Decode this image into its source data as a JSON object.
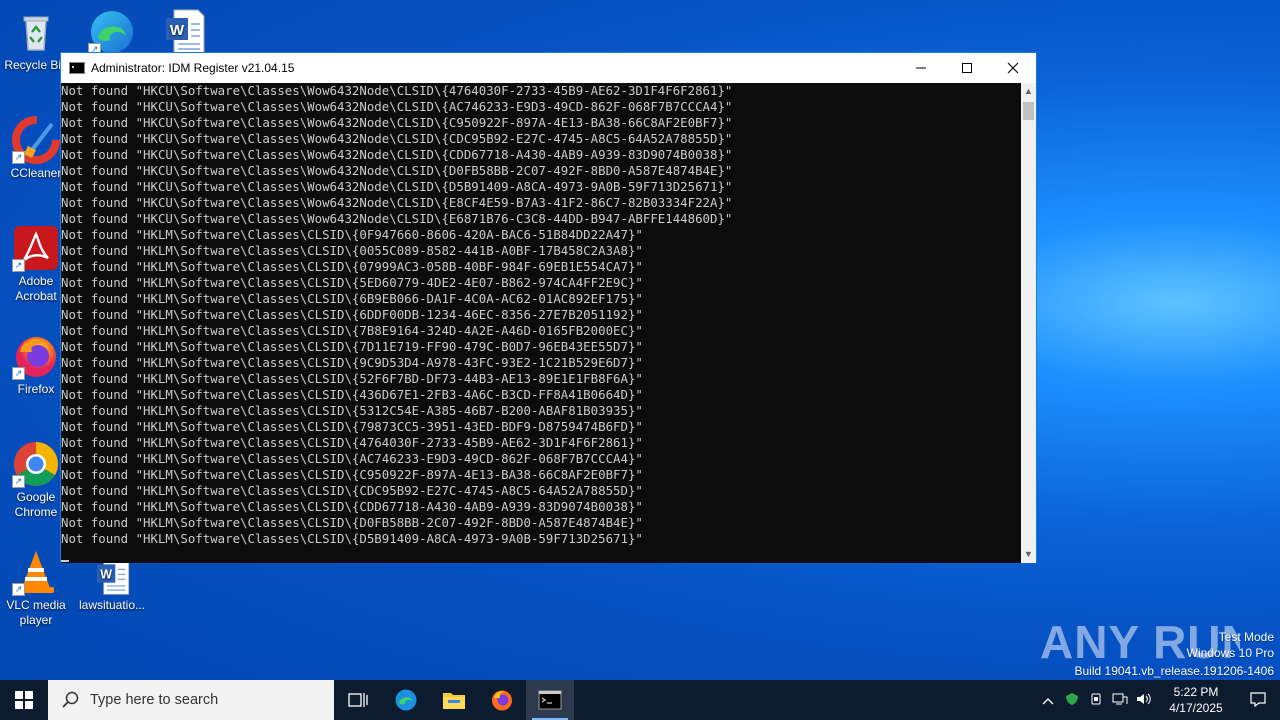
{
  "desktop": {
    "icons": [
      {
        "label": "Recycle Bin"
      },
      {
        "label": "CCleaner"
      },
      {
        "label": "Adobe Acrobat"
      },
      {
        "label": "Firefox"
      },
      {
        "label": "Google Chrome"
      },
      {
        "label": "VLC media player"
      },
      {
        "label": "lawsituatio..."
      }
    ]
  },
  "window": {
    "title": "Administrator:  IDM Register v21.04.15",
    "console_lines": [
      "Not found \"HKCU\\Software\\Classes\\Wow6432Node\\CLSID\\{4764030F-2733-45B9-AE62-3D1F4F6F2861}\"",
      "Not found \"HKCU\\Software\\Classes\\Wow6432Node\\CLSID\\{AC746233-E9D3-49CD-862F-068F7B7CCCA4}\"",
      "Not found \"HKCU\\Software\\Classes\\Wow6432Node\\CLSID\\{C950922F-897A-4E13-BA38-66C8AF2E0BF7}\"",
      "Not found \"HKCU\\Software\\Classes\\Wow6432Node\\CLSID\\{CDC95B92-E27C-4745-A8C5-64A52A78855D}\"",
      "Not found \"HKCU\\Software\\Classes\\Wow6432Node\\CLSID\\{CDD67718-A430-4AB9-A939-83D9074B0038}\"",
      "Not found \"HKCU\\Software\\Classes\\Wow6432Node\\CLSID\\{D0FB58BB-2C07-492F-8BD0-A587E4874B4E}\"",
      "Not found \"HKCU\\Software\\Classes\\Wow6432Node\\CLSID\\{D5B91409-A8CA-4973-9A0B-59F713D25671}\"",
      "Not found \"HKCU\\Software\\Classes\\Wow6432Node\\CLSID\\{E8CF4E59-B7A3-41F2-86C7-82B03334F22A}\"",
      "Not found \"HKCU\\Software\\Classes\\Wow6432Node\\CLSID\\{E6871B76-C3C8-44DD-B947-ABFFE144860D}\"",
      "Not found \"HKLM\\Software\\Classes\\CLSID\\{0F947660-8606-420A-BAC6-51B84DD22A47}\"",
      "Not found \"HKLM\\Software\\Classes\\CLSID\\{0055C089-8582-441B-A0BF-17B458C2A3A8}\"",
      "Not found \"HKLM\\Software\\Classes\\CLSID\\{07999AC3-058B-40BF-984F-69EB1E554CA7}\"",
      "Not found \"HKLM\\Software\\Classes\\CLSID\\{5ED60779-4DE2-4E07-B862-974CA4FF2E9C}\"",
      "Not found \"HKLM\\Software\\Classes\\CLSID\\{6B9EB066-DA1F-4C0A-AC62-01AC892EF175}\"",
      "Not found \"HKLM\\Software\\Classes\\CLSID\\{6DDF00DB-1234-46EC-8356-27E7B2051192}\"",
      "Not found \"HKLM\\Software\\Classes\\CLSID\\{7B8E9164-324D-4A2E-A46D-0165FB2000EC}\"",
      "Not found \"HKLM\\Software\\Classes\\CLSID\\{7D11E719-FF90-479C-B0D7-96EB43EE55D7}\"",
      "Not found \"HKLM\\Software\\Classes\\CLSID\\{9C9D53D4-A978-43FC-93E2-1C21B529E6D7}\"",
      "Not found \"HKLM\\Software\\Classes\\CLSID\\{52F6F7BD-DF73-44B3-AE13-89E1E1FB8F6A}\"",
      "Not found \"HKLM\\Software\\Classes\\CLSID\\{436D67E1-2FB3-4A6C-B3CD-FF8A41B0664D}\"",
      "Not found \"HKLM\\Software\\Classes\\CLSID\\{5312C54E-A385-46B7-B200-ABAF81B03935}\"",
      "Not found \"HKLM\\Software\\Classes\\CLSID\\{79873CC5-3951-43ED-BDF9-D8759474B6FD}\"",
      "Not found \"HKLM\\Software\\Classes\\CLSID\\{4764030F-2733-45B9-AE62-3D1F4F6F2861}\"",
      "Not found \"HKLM\\Software\\Classes\\CLSID\\{AC746233-E9D3-49CD-862F-068F7B7CCCA4}\"",
      "Not found \"HKLM\\Software\\Classes\\CLSID\\{C950922F-897A-4E13-BA38-66C8AF2E0BF7}\"",
      "Not found \"HKLM\\Software\\Classes\\CLSID\\{CDC95B92-E27C-4745-A8C5-64A52A78855D}\"",
      "Not found \"HKLM\\Software\\Classes\\CLSID\\{CDD67718-A430-4AB9-A939-83D9074B0038}\"",
      "Not found \"HKLM\\Software\\Classes\\CLSID\\{D0FB58BB-2C07-492F-8BD0-A587E4874B4E}\"",
      "Not found \"HKLM\\Software\\Classes\\CLSID\\{D5B91409-A8CA-4973-9A0B-59F713D25671}\""
    ]
  },
  "watermark": {
    "brand": "ANY RUN",
    "test_mode": "Test Mode",
    "edition": "Windows 10 Pro",
    "build": "Build 19041.vb_release.191206-1406"
  },
  "taskbar": {
    "search_placeholder": "Type here to search",
    "time": "5:22 PM",
    "date": "4/17/2025"
  },
  "colors": {
    "taskbar": "#0d1b2e",
    "console_bg": "#0c0c0c",
    "console_text": "#cccccc",
    "window_border": "#1f7bd1"
  }
}
